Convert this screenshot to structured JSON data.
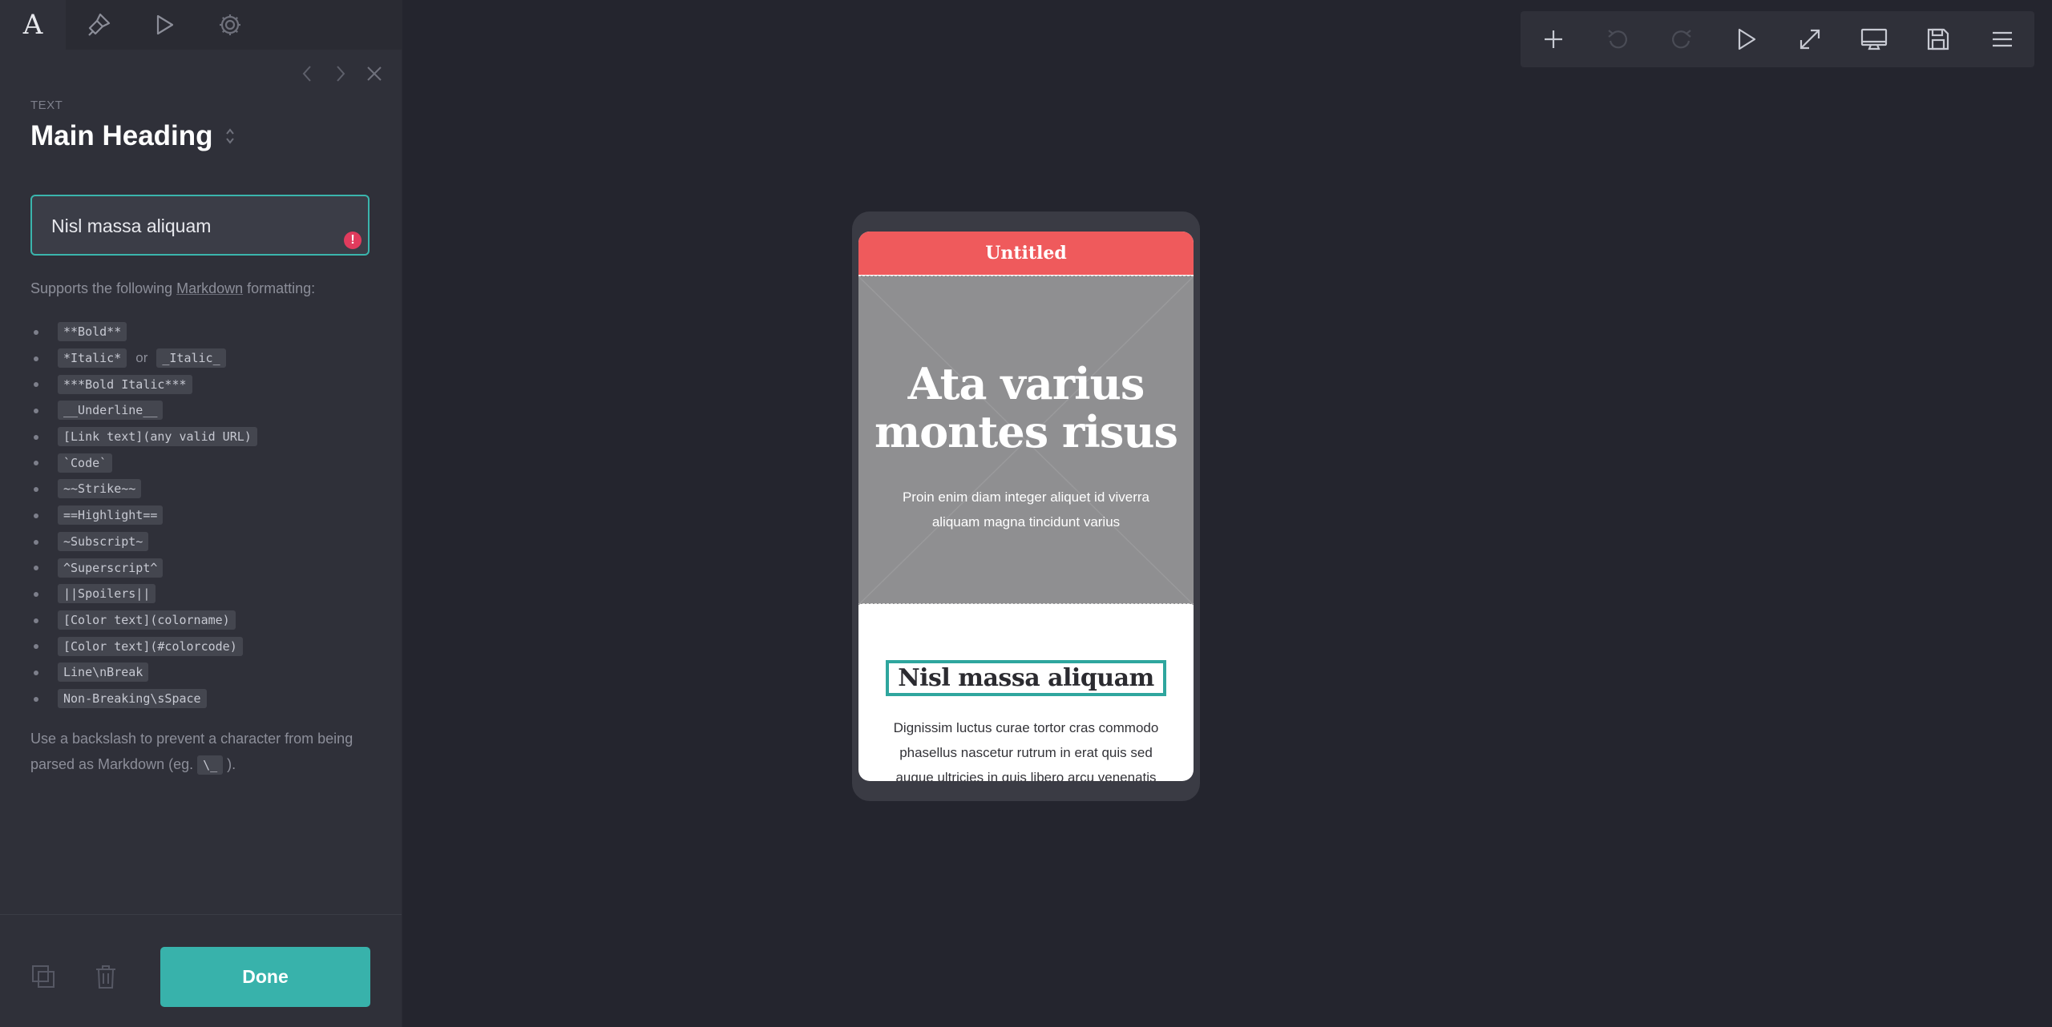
{
  "sidebar_tabs": [
    {
      "name": "text",
      "icon": "text-A-icon",
      "label": "A"
    },
    {
      "name": "style",
      "icon": "brush-icon"
    },
    {
      "name": "play",
      "icon": "play-icon"
    },
    {
      "name": "settings",
      "icon": "gear-icon"
    }
  ],
  "editor": {
    "type_label": "TEXT",
    "heading": "Main Heading",
    "input_value": "Nisl massa aliquam",
    "help_prefix": "Supports the following ",
    "help_link": "Markdown",
    "help_suffix": " formatting:",
    "markdown_items": [
      {
        "code": "**Bold**"
      },
      {
        "code": "*Italic*",
        "or": "or",
        "code2": "_Italic_"
      },
      {
        "code": "***Bold Italic***"
      },
      {
        "code": "__Underline__"
      },
      {
        "code": "[Link text](any valid URL)"
      },
      {
        "code": "`Code`"
      },
      {
        "code": "~~Strike~~"
      },
      {
        "code": "==Highlight=="
      },
      {
        "code": "~Subscript~"
      },
      {
        "code": "^Superscript^"
      },
      {
        "code": "||Spoilers||"
      },
      {
        "code": "[Color text](colorname)"
      },
      {
        "code": "[Color text](#colorcode)"
      },
      {
        "code": "Line\\nBreak"
      },
      {
        "code": "Non-Breaking\\sSpace"
      }
    ],
    "footnote_prefix": "Use a backslash to prevent a character from being parsed as Markdown (eg. ",
    "footnote_code": "\\_",
    "footnote_suffix": " ).",
    "done_label": "Done"
  },
  "toolbar": {
    "buttons": [
      "add-icon",
      "undo-icon",
      "redo-icon",
      "play-icon",
      "expand-icon",
      "desktop-icon",
      "save-icon",
      "menu-icon"
    ]
  },
  "preview": {
    "app_title": "Untitled",
    "hero_title_line1": "Ata varius",
    "hero_title_line2": "montes risus",
    "hero_subtitle": "Proin enim diam integer aliquet id viverra aliquam magna tincidunt varius",
    "section_heading": "Nisl massa aliquam",
    "body_text": "Dignissim luctus curae tortor cras commodo phasellus nascetur rutrum in erat quis sed augue ultricies in quis libero arcu venenatis"
  },
  "colors": {
    "accent": "#38b2ab",
    "app_bar": "#ef5a5c",
    "error": "#e03b5d",
    "background": "#24252e",
    "panel": "#2f3039"
  }
}
